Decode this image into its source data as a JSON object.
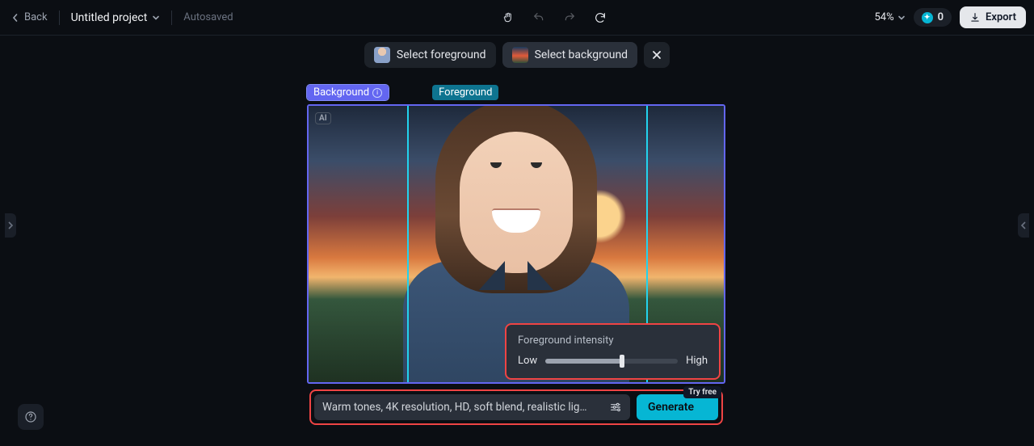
{
  "topbar": {
    "back_label": "Back",
    "project_title": "Untitled project",
    "autosave_label": "Autosaved",
    "zoom_label": "54%",
    "credits_value": "0",
    "export_label": "Export"
  },
  "selection": {
    "foreground_label": "Select foreground",
    "background_label": "Select background"
  },
  "layers": {
    "background_tag": "Background",
    "foreground_tag": "Foreground",
    "ai_chip": "AI"
  },
  "intensity": {
    "title": "Foreground intensity",
    "low_label": "Low",
    "high_label": "High",
    "value_pct": 58
  },
  "prompt": {
    "text": "Warm tones, 4K resolution, HD, soft blend, realistic lig…",
    "generate_label": "Generate",
    "try_free_label": "Try free"
  },
  "colors": {
    "accent_indigo": "#6366f1",
    "accent_cyan": "#06b6d4",
    "highlight_red": "#ef4444"
  }
}
